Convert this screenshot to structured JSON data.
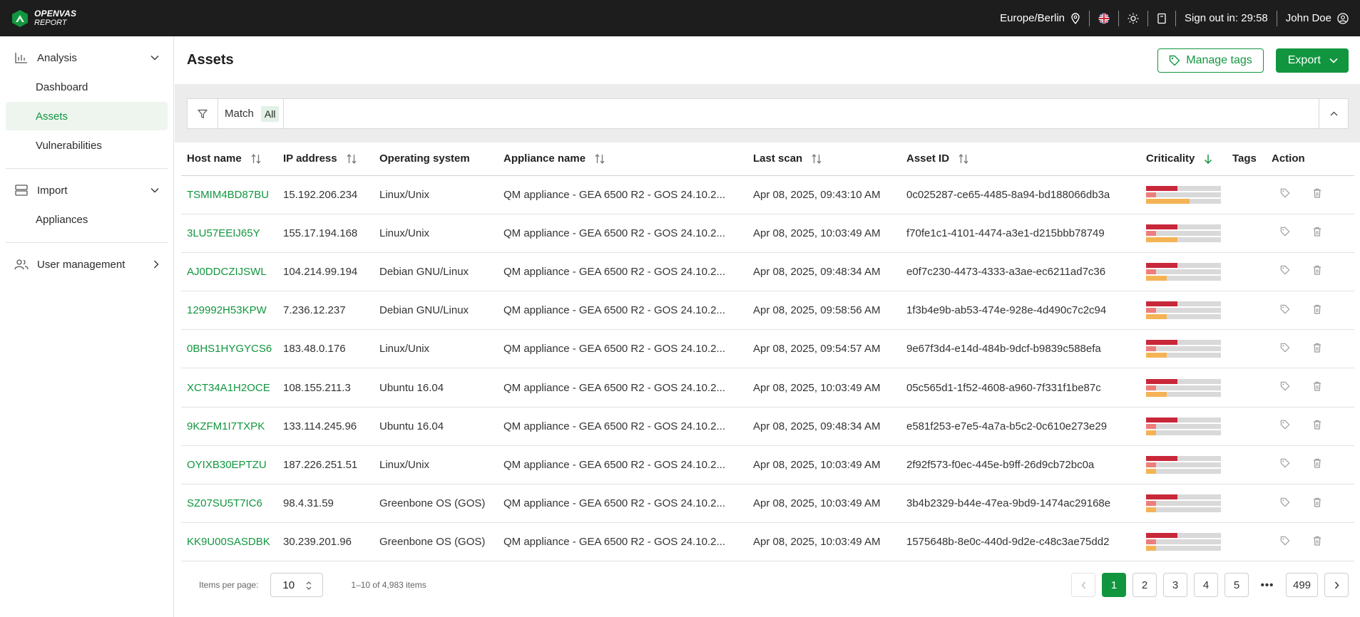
{
  "brand": {
    "line1": "OPENVAS",
    "line2": "REPORT"
  },
  "topbar": {
    "timezone": "Europe/Berlin",
    "signout": "Sign out in: 29:58",
    "user": "John Doe"
  },
  "sidebar": {
    "analysis": "Analysis",
    "dashboard": "Dashboard",
    "assets": "Assets",
    "vulnerabilities": "Vulnerabilities",
    "import": "Import",
    "appliances": "Appliances",
    "user_management": "User management"
  },
  "page": {
    "title": "Assets",
    "manage_tags": "Manage tags",
    "export": "Export"
  },
  "filter": {
    "match": "Match",
    "chip": "All"
  },
  "table": {
    "headers": {
      "host": "Host name",
      "ip": "IP address",
      "os": "Operating system",
      "appliance": "Appliance name",
      "scan": "Last scan",
      "asset_id": "Asset ID",
      "crit": "Criticality",
      "tags": "Tags",
      "action": "Action"
    },
    "rows": [
      {
        "host": "TSMIM4BD87BU",
        "ip": "15.192.206.234",
        "os": "Linux/Unix",
        "appliance": "QM appliance - GEA 6500 R2 - GOS 24.10.2...",
        "scan": "Apr 08, 2025, 09:43:10 AM",
        "asset_id": "0c025287-ce65-4485-8a94-bd188066db3a"
      },
      {
        "host": "3LU57EEIJ65Y",
        "ip": "155.17.194.168",
        "os": "Linux/Unix",
        "appliance": "QM appliance - GEA 6500 R2 - GOS 24.10.2...",
        "scan": "Apr 08, 2025, 10:03:49 AM",
        "asset_id": "f70fe1c1-4101-4474-a3e1-d215bbb78749"
      },
      {
        "host": "AJ0DDCZIJSWL",
        "ip": "104.214.99.194",
        "os": "Debian GNU/Linux",
        "appliance": "QM appliance - GEA 6500 R2 - GOS 24.10.2...",
        "scan": "Apr 08, 2025, 09:48:34 AM",
        "asset_id": "e0f7c230-4473-4333-a3ae-ec6211ad7c36"
      },
      {
        "host": "129992H53KPW",
        "ip": "7.236.12.237",
        "os": "Debian GNU/Linux",
        "appliance": "QM appliance - GEA 6500 R2 - GOS 24.10.2...",
        "scan": "Apr 08, 2025, 09:58:56 AM",
        "asset_id": "1f3b4e9b-ab53-474e-928e-4d490c7c2c94"
      },
      {
        "host": "0BHS1HYGYCS6",
        "ip": "183.48.0.176",
        "os": "Linux/Unix",
        "appliance": "QM appliance - GEA 6500 R2 - GOS 24.10.2...",
        "scan": "Apr 08, 2025, 09:54:57 AM",
        "asset_id": "9e67f3d4-e14d-484b-9dcf-b9839c588efa"
      },
      {
        "host": "XCT34A1H2OCE",
        "ip": "108.155.211.3",
        "os": "Ubuntu 16.04",
        "appliance": "QM appliance - GEA 6500 R2 - GOS 24.10.2...",
        "scan": "Apr 08, 2025, 10:03:49 AM",
        "asset_id": "05c565d1-1f52-4608-a960-7f331f1be87c"
      },
      {
        "host": "9KZFM1I7TXPK",
        "ip": "133.114.245.96",
        "os": "Ubuntu 16.04",
        "appliance": "QM appliance - GEA 6500 R2 - GOS 24.10.2...",
        "scan": "Apr 08, 2025, 09:48:34 AM",
        "asset_id": "e581f253-e7e5-4a7a-b5c2-0c610e273e29"
      },
      {
        "host": "OYIXB30EPTZU",
        "ip": "187.226.251.51",
        "os": "Linux/Unix",
        "appliance": "QM appliance - GEA 6500 R2 - GOS 24.10.2...",
        "scan": "Apr 08, 2025, 10:03:49 AM",
        "asset_id": "2f92f573-f0ec-445e-b9ff-26d9cb72bc0a"
      },
      {
        "host": "SZ07SU5T7IC6",
        "ip": "98.4.31.59",
        "os": "Greenbone OS (GOS)",
        "appliance": "QM appliance - GEA 6500 R2 - GOS 24.10.2...",
        "scan": "Apr 08, 2025, 10:03:49 AM",
        "asset_id": "3b4b2329-b44e-47ea-9bd9-1474ac29168e"
      },
      {
        "host": "KK9U00SASDBK",
        "ip": "30.239.201.96",
        "os": "Greenbone OS (GOS)",
        "appliance": "QM appliance - GEA 6500 R2 - GOS 24.10.2...",
        "scan": "Apr 08, 2025, 10:03:49 AM",
        "asset_id": "1575648b-8e0c-440d-9d2e-c48c3ae75dd2"
      }
    ]
  },
  "criticality": {
    "colors": {
      "high": "#c8283a",
      "medium": "#ee7e7c",
      "low": "#f4b354",
      "track": "#d9d9d9"
    },
    "rows": [
      [
        0.42,
        0.13,
        0.58
      ],
      [
        0.42,
        0.13,
        0.42
      ],
      [
        0.42,
        0.13,
        0.28
      ],
      [
        0.42,
        0.13,
        0.28
      ],
      [
        0.42,
        0.13,
        0.28
      ],
      [
        0.42,
        0.13,
        0.28
      ],
      [
        0.42,
        0.13,
        0.13
      ],
      [
        0.42,
        0.13,
        0.13
      ],
      [
        0.42,
        0.13,
        0.13
      ],
      [
        0.42,
        0.13,
        0.13
      ]
    ]
  },
  "pagination": {
    "items_per_page_label": "Items per page:",
    "items_per_page": "10",
    "range": "1–10 of 4,983 items",
    "pages": [
      "1",
      "2",
      "3",
      "4",
      "5"
    ],
    "ellipsis": "•••",
    "last_page": "499",
    "current": "1"
  },
  "accent": "#11963f"
}
